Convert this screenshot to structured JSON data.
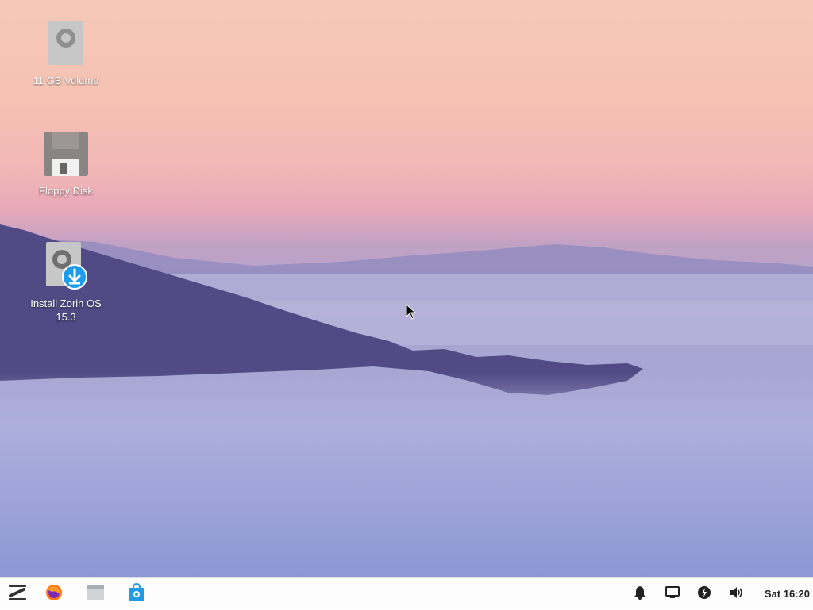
{
  "desktop": {
    "icons": [
      {
        "label": "11 GB Volume",
        "icon": "drive-icon"
      },
      {
        "label": "Floppy Disk",
        "icon": "floppy-disk-icon"
      },
      {
        "label": "Install Zorin OS 15.3",
        "icon": "installer-icon"
      }
    ]
  },
  "taskbar": {
    "launchers": [
      {
        "name": "zorin-menu",
        "icon": "zorin-logo-icon"
      },
      {
        "name": "firefox",
        "icon": "firefox-icon"
      },
      {
        "name": "files",
        "icon": "files-icon"
      },
      {
        "name": "software",
        "icon": "software-store-icon"
      }
    ],
    "tray": [
      "bell-icon",
      "display-icon",
      "power-icon",
      "volume-icon"
    ],
    "clock": "Sat 16:20"
  },
  "colors": {
    "accent": "#1e9be9",
    "taskbar_bg": "#fdfdfd"
  }
}
